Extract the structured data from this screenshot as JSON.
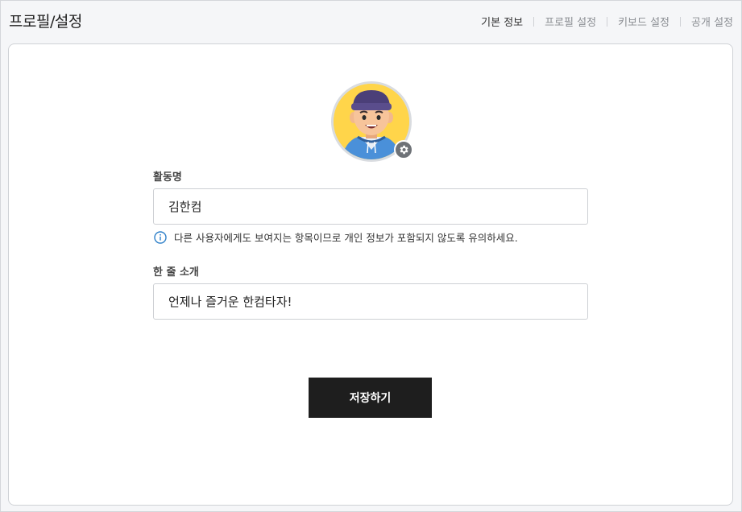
{
  "header": {
    "title": "프로필/설정",
    "tabs": [
      {
        "label": "기본 정보",
        "active": true
      },
      {
        "label": "프로필 설정",
        "active": false
      },
      {
        "label": "키보드 설정",
        "active": false
      },
      {
        "label": "공개 설정",
        "active": false
      }
    ]
  },
  "profile": {
    "nickname": {
      "label": "활동명",
      "value": "김한컴"
    },
    "hint": "다른 사용자에게도 보여지는 항목이므로 개인 정보가 포함되지 않도록 유의하세요.",
    "intro": {
      "label": "한 줄 소개",
      "value": "언제나 즐거운 한컴타자!"
    },
    "save_label": "저장하기"
  },
  "colors": {
    "accent_info": "#2f80c9",
    "avatar_bg": "#ffd54a",
    "button_bg": "#1e1e1e"
  },
  "icons": {
    "settings": "gear-icon",
    "info": "info-icon"
  }
}
